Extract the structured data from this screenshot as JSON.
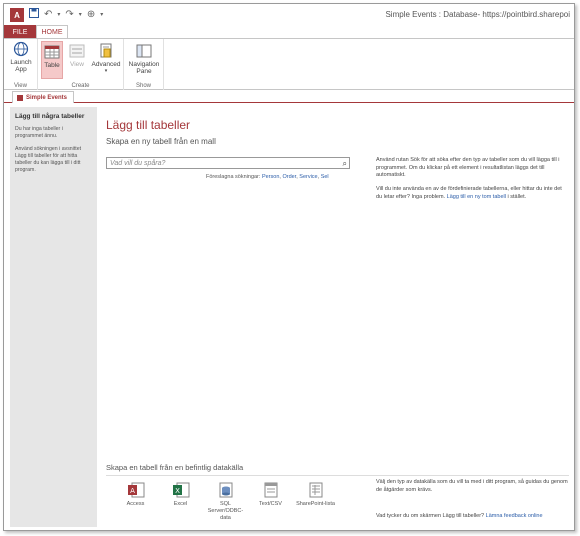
{
  "window": {
    "title": "Simple Events : Database- https://pointbird.sharepoi",
    "app_badge": "A"
  },
  "ribbon": {
    "tabs": [
      "FILE",
      "HOME"
    ],
    "groups": {
      "view": {
        "label": "View",
        "launch_app": "Launch App"
      },
      "create": {
        "label": "Create",
        "table": "Table",
        "view": "View",
        "advanced": "Advanced"
      },
      "show": {
        "label": "Show",
        "navigation_pane": "Navigation Pane"
      }
    }
  },
  "document_tab": {
    "label": "Simple Events"
  },
  "left_pane": {
    "title": "Lägg till några tabeller",
    "para1": "Du har inga tabeller i programmet ännu.",
    "para2": "Använd sökningen i avsnittet Lägg till tabeller för att hitta tabeller du kan lägga till i ditt program."
  },
  "main": {
    "title": "Lägg till tabeller",
    "subtitle": "Skapa en ny tabell från en mall",
    "search_placeholder": "Vad vill du spåra?",
    "suggestions_prefix": "Föreslagna sökningar:",
    "suggestions": [
      "Person",
      "Order",
      "Service",
      "Sel"
    ],
    "help_search": "Använd rutan Sök för att söka efter den typ av tabeller som du vill lägga till i programmet. Om du klickar på ett element i resultatlistan läggs det till automatiskt.",
    "help_blank_prefix": "Vill du inte använda en av de fördefinierade tabellerna, eller hittar du inte det du letar efter? Inga problem.",
    "help_blank_link": "Lägg till en ny tom tabell",
    "help_blank_suffix": "i stället.",
    "existing_title": "Skapa en tabell från en befintlig datakälla",
    "sources": [
      "Access",
      "Excel",
      "SQL Server/ODBC-data",
      "Text/CSV",
      "SharePoint-lista"
    ],
    "help_sources": "Välj den typ av datakälla som du vill ta med i ditt program, så guidas du genom de åtgärder som krävs.",
    "feedback_prefix": "Vad tycker du om skärmen Lägg till tabeller?",
    "feedback_link": "Lämna feedback online"
  },
  "colors": {
    "accent": "#a4373a",
    "link": "#2a5ca8"
  }
}
